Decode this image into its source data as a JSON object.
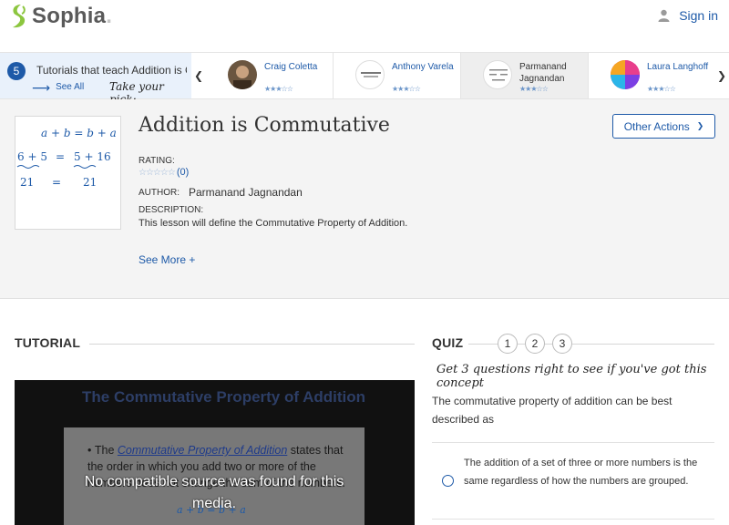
{
  "header": {
    "brand": "Sophia",
    "brand_dot": ".",
    "signin_label": "Sign in"
  },
  "tutorials_bar": {
    "count": "5",
    "label": "Tutorials that teach Addition is Commutative",
    "see_all": "See All",
    "take_pick": "Take your pick:",
    "cards": [
      {
        "name": "Craig Coletta",
        "stars": "★★★☆☆"
      },
      {
        "name": "Anthony Varela",
        "stars": "★★★☆☆"
      },
      {
        "name": "Parmanand\nJagnandan",
        "stars": "★★★☆☆"
      },
      {
        "name": "Laura Langhoff",
        "stars": "★★★☆☆"
      }
    ]
  },
  "lesson": {
    "title": "Addition is Commutative",
    "other_actions": "Other Actions",
    "rating_label": "RATING:",
    "rating_stars": "☆☆☆☆☆",
    "rating_count": "(0)",
    "author_label": "AUTHOR:",
    "author": "Parmanand Jagnandan",
    "description_label": "DESCRIPTION:",
    "description": "This lesson will define the Commutative Property of Addition.",
    "see_more": "See More +",
    "thumb": {
      "line1": "a + b = b + a",
      "line2_left": "6 + 5",
      "line2_eq": "=",
      "line2_right": "5 + 16",
      "line3_left": "21",
      "line3_eq": "=",
      "line3_right": "21"
    }
  },
  "tutorial": {
    "title": "TUTORIAL",
    "slide_title": "The Commutative Property of Addition",
    "slide_bullet_pre": "The ",
    "slide_bullet_em": "Commutative Property of Addition",
    "slide_bullet_post": " states that the order in which you add two or more of the numbers does not change the sum of the numbers.",
    "slide_formula": "a + b = b + a",
    "error": "No compatible source was found for this media."
  },
  "quiz": {
    "title": "QUIZ",
    "steps": [
      "1",
      "2",
      "3"
    ],
    "tagline": "Get 3 questions right to see if you've got this concept",
    "question": "The commutative property of addition can be best described as",
    "answer": "The addition of a set of three or more numbers is the same regardless of how the numbers are grouped."
  }
}
